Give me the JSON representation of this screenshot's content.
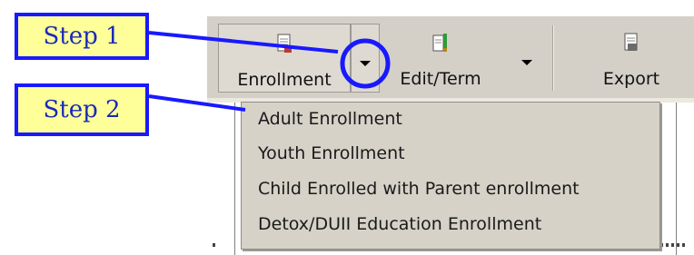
{
  "toolbar": {
    "enrollment_label": "Enrollment",
    "edit_term_label": "Edit/Term",
    "export_label": "Export"
  },
  "menu": {
    "items": [
      "Adult Enrollment",
      "Youth Enrollment",
      "Child Enrolled with Parent enrollment",
      "Detox/DUII Education Enrollment"
    ]
  },
  "callouts": {
    "step1": "Step 1",
    "step2": "Step 2",
    "color": "#1919ff",
    "fill": "#ffff99"
  },
  "icons": {
    "enrollment": "enrollment-document-icon",
    "edit_term": "edit-term-icon",
    "export": "export-icon",
    "dropdown": "dropdown-arrow-icon"
  }
}
